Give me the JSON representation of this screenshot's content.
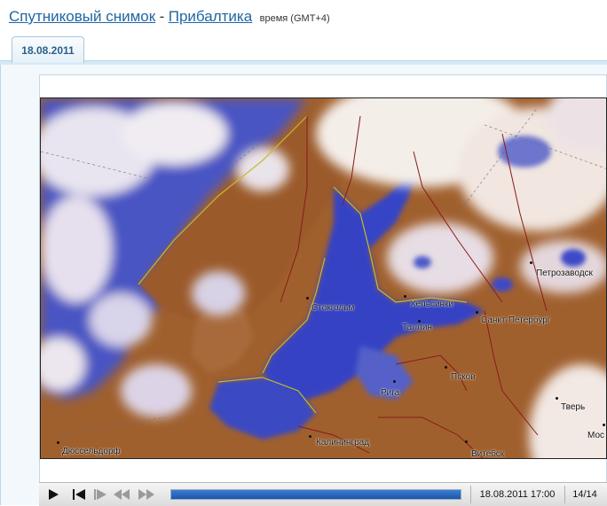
{
  "header": {
    "title_link": "Спутниковый снимок",
    "separator": "-",
    "region_link": "Прибалтика",
    "timezone": "время (GMT+4)"
  },
  "tabs": [
    {
      "label": "18.08.2011",
      "active": true
    }
  ],
  "map": {
    "cities": [
      {
        "name": "Петрозаводск"
      },
      {
        "name": "Стокгольм"
      },
      {
        "name": "Хельсинки"
      },
      {
        "name": "Санкт-Петербург"
      },
      {
        "name": "Таллин"
      },
      {
        "name": "Псков"
      },
      {
        "name": "Рига"
      },
      {
        "name": "Тверь"
      },
      {
        "name": "Мос"
      },
      {
        "name": "Дюссельдорф"
      },
      {
        "name": "Калининград"
      },
      {
        "name": "Витебск"
      }
    ]
  },
  "player": {
    "datetime": "18.08.2011 17:00",
    "frame": "14/14",
    "progress": 1.0,
    "buttons": {
      "play": "play-icon",
      "step_back": "step-back-icon",
      "step_forward": "step-forward-icon",
      "rewind": "rewind-icon",
      "fast_forward": "fast-forward-icon"
    }
  },
  "colors": {
    "link": "#1f66a3",
    "land": "#a0602e",
    "water_cloud": "#3a4dc4",
    "cloud": "#f3ece8",
    "border": "#8a1a1a",
    "coast": "#b7b21f",
    "progress": "#1e55a8"
  }
}
